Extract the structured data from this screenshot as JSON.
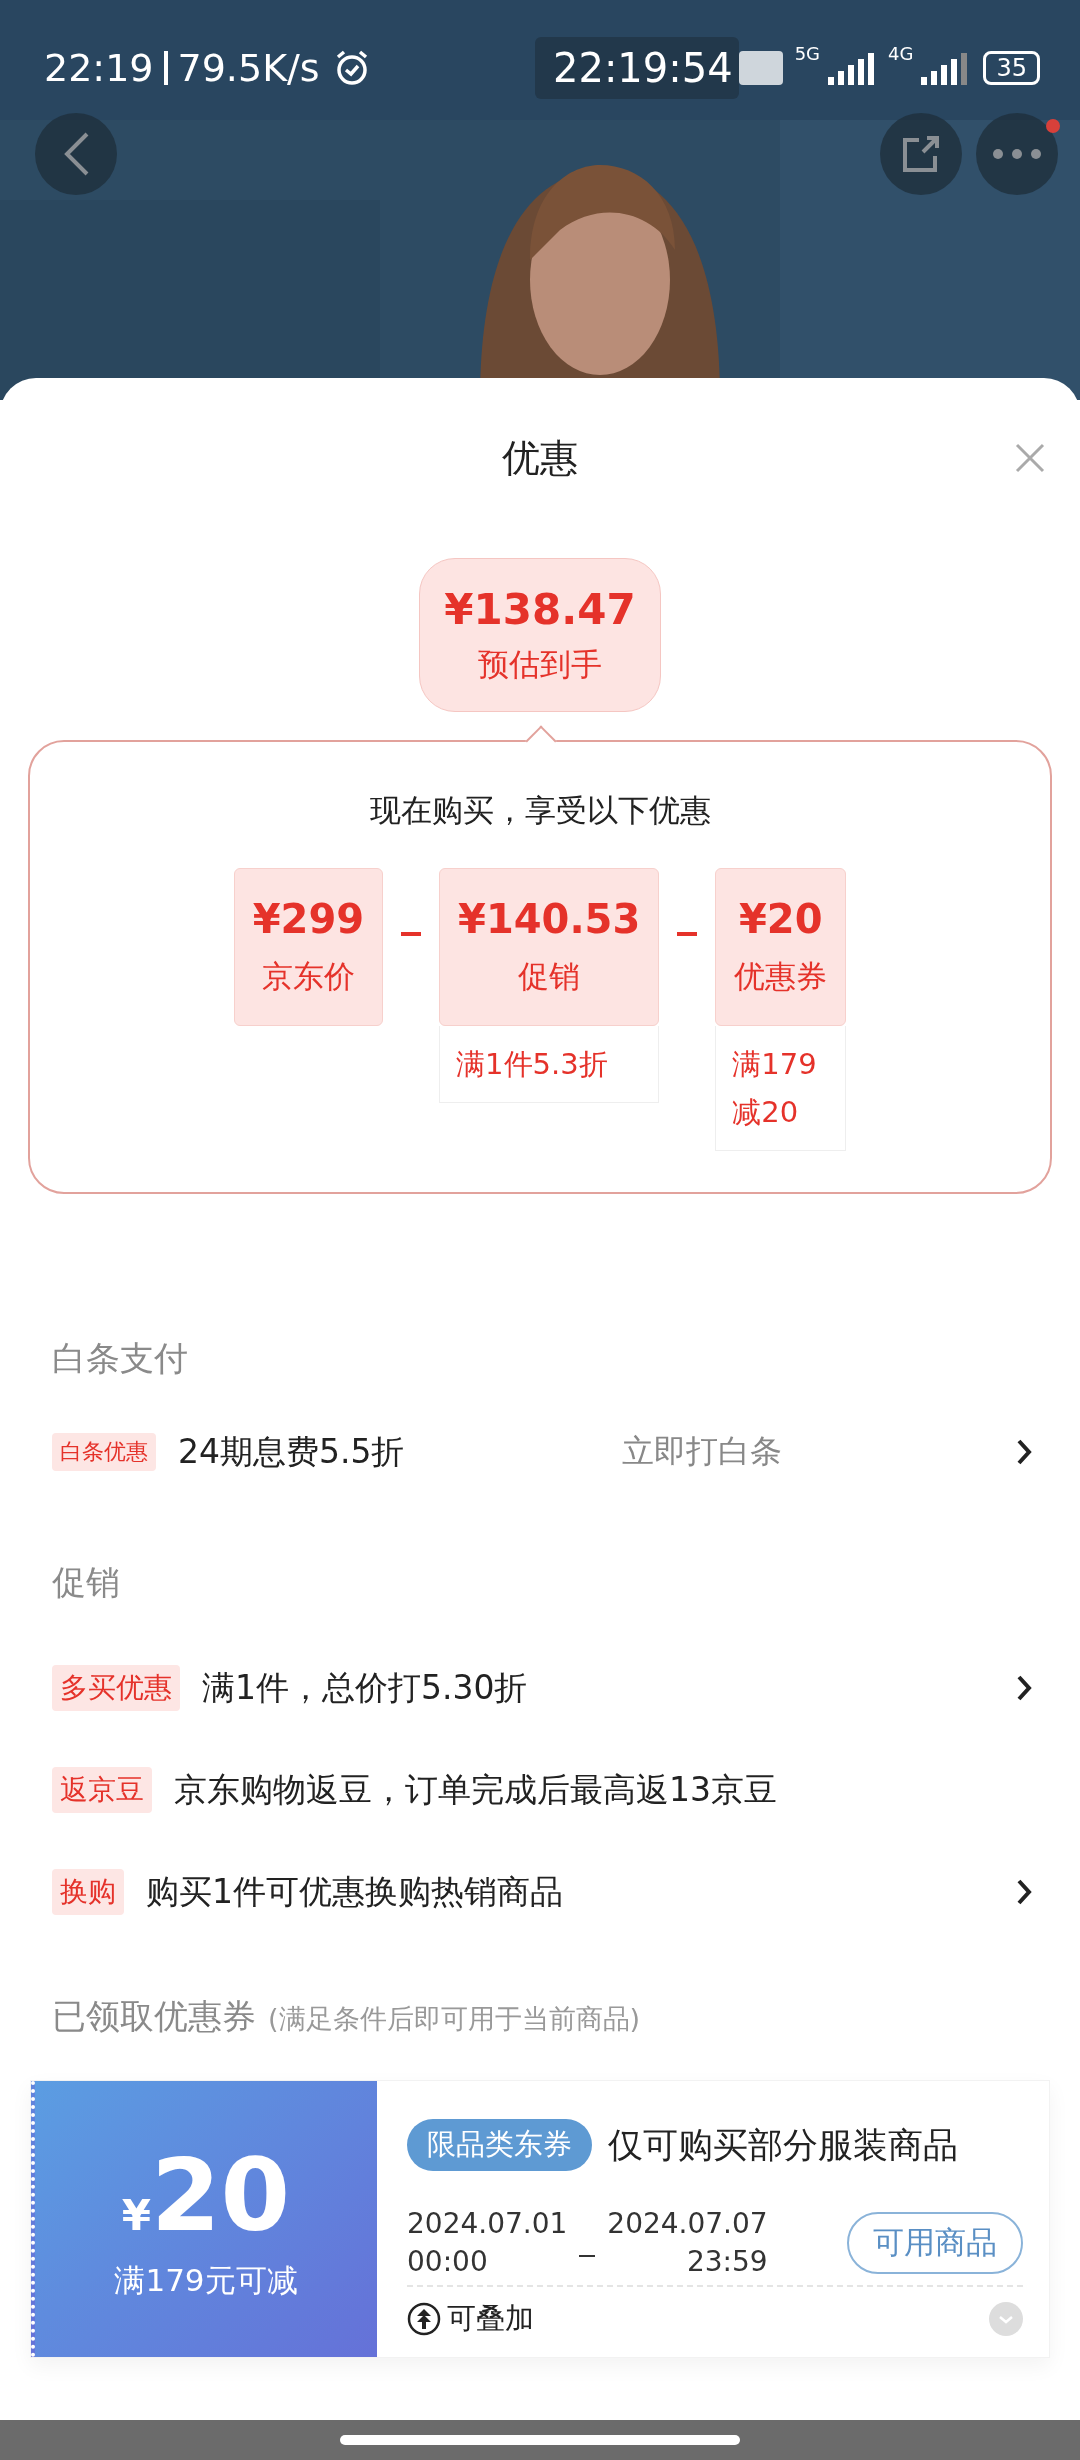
{
  "status_bar": {
    "time": "22:19",
    "speed": "79.5K/s",
    "clock": "22:19:54",
    "network_1": "5G",
    "network_2": "4G",
    "battery": "35"
  },
  "nav": {
    "more_dot": true
  },
  "sheet": {
    "title": "优惠"
  },
  "estimate": {
    "price": "¥138.47",
    "label": "预估到手"
  },
  "breakdown": {
    "heading": "现在购买，享受以下优惠",
    "items": [
      {
        "price": "¥299",
        "label": "京东价"
      },
      {
        "price": "¥140.53",
        "label": "促销",
        "note_lines": [
          "满1件5.3折"
        ]
      },
      {
        "price": "¥20",
        "label": "优惠券",
        "note_lines": [
          "满179",
          "减20"
        ]
      }
    ]
  },
  "baitiao": {
    "title": "白条支付",
    "tag": "白条优惠",
    "text": "24期息费5.5折",
    "action": "立即打白条"
  },
  "promotions": {
    "title": "促销",
    "items": [
      {
        "tag": "多买优惠",
        "text": "满1件，总价打5.30折",
        "has_arrow": true
      },
      {
        "tag": "返京豆",
        "text": "京东购物返豆，订单完成后最高返13京豆",
        "has_arrow": false
      },
      {
        "tag": "换购",
        "text": "购买1件可优惠换购热销商品",
        "has_arrow": true
      }
    ]
  },
  "coupons": {
    "title": "已领取优惠券",
    "hint": "(满足条件后即可用于当前商品)",
    "items": [
      {
        "currency": "¥",
        "amount": "20",
        "condition": "满179元可减",
        "tag": "限品类东券",
        "desc": "仅可购买部分服装商品",
        "start_date": "2024.07.01",
        "start_time": "00:00",
        "end_date": "2024.07.07",
        "end_time": "23:59",
        "stack": "可叠加",
        "button": "可用商品"
      }
    ]
  }
}
